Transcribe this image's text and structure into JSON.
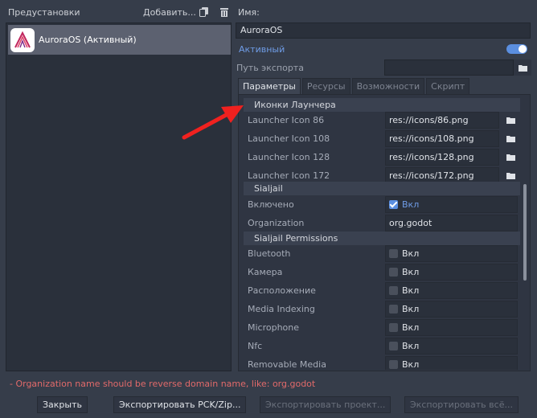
{
  "presets": {
    "label": "Предустановки",
    "add_label": "Добавить...",
    "items": [
      {
        "name": "AuroraOS (Активный)"
      }
    ]
  },
  "preset_details": {
    "name_label": "Имя:",
    "name_value": "AuroraOS",
    "runnable_label": "Активный",
    "runnable_on": true,
    "export_path_label": "Путь экспорта",
    "export_path_value": ""
  },
  "tabs": [
    {
      "label": "Параметры",
      "active": true
    },
    {
      "label": "Ресурсы",
      "active": false
    },
    {
      "label": "Возможности",
      "active": false
    },
    {
      "label": "Скрипт",
      "active": false
    }
  ],
  "options": {
    "launcher_icons_header": "Иконки Лаунчера",
    "launcher_icons": [
      {
        "label": "Launcher Icon 86",
        "value": "res://icons/86.png"
      },
      {
        "label": "Launcher Icon 108",
        "value": "res://icons/108.png"
      },
      {
        "label": "Launcher Icon 128",
        "value": "res://icons/128.png"
      },
      {
        "label": "Launcher Icon 172",
        "value": "res://icons/172.png"
      }
    ],
    "sailjail_header": "Sialjail",
    "sailjail_enabled_label": "Включено",
    "sailjail_enabled_value": "Вкл",
    "organization_label": "Organization",
    "organization_value": "org.godot",
    "permissions_header": "Sialjail Permissions",
    "permissions": [
      {
        "label": "Bluetooth",
        "value": "Вкл"
      },
      {
        "label": "Камера",
        "value": "Вкл"
      },
      {
        "label": "Расположение",
        "value": "Вкл"
      },
      {
        "label": "Media Indexing",
        "value": "Вкл"
      },
      {
        "label": "Microphone",
        "value": "Вкл"
      },
      {
        "label": "Nfc",
        "value": "Вкл"
      },
      {
        "label": "Removable Media",
        "value": "Вкл"
      }
    ]
  },
  "error_message": "- Organization name should be reverse domain name, like: org.godot",
  "buttons": {
    "close": "Закрыть",
    "export_pck": "Экспортировать PCK/Zip...",
    "export_project": "Экспортировать проект...",
    "export_all": "Экспортировать всё..."
  },
  "colors": {
    "accent": "#5b8fe0",
    "error": "#e26a6a",
    "annotation_arrow": "#f0211f"
  },
  "icons": {
    "duplicate": "duplicate-icon",
    "delete": "trash-icon",
    "folder": "folder-icon",
    "app": "aurora-logo-icon"
  }
}
